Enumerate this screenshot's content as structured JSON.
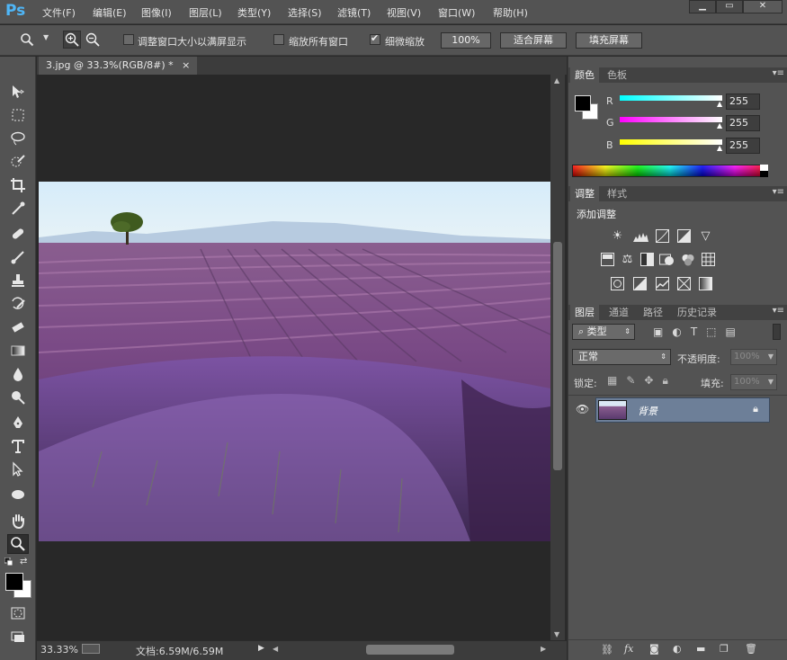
{
  "app": {
    "logo": "Ps"
  },
  "menu": [
    "文件(F)",
    "编辑(E)",
    "图像(I)",
    "图层(L)",
    "类型(Y)",
    "选择(S)",
    "滤镜(T)",
    "视图(V)",
    "窗口(W)",
    "帮助(H)"
  ],
  "window_controls": {
    "minimize": "▁",
    "restore": "▭",
    "close": "✕"
  },
  "options": {
    "fit_window_label": "调整窗口大小以满屏显示",
    "zoom_all_label": "缩放所有窗口",
    "scrubby_label": "细微缩放",
    "btn_100": "100%",
    "btn_fit": "适合屏幕",
    "btn_fill": "填充屏幕"
  },
  "document": {
    "tab_label": "3.jpg @ 33.3%(RGB/8#) *",
    "tab_close": "×",
    "zoom": "33.33%",
    "doc_size": "文档:6.59M/6.59M"
  },
  "color_panel": {
    "tabs": [
      "颜色",
      "色板"
    ],
    "channels": [
      {
        "label": "R",
        "value": "255"
      },
      {
        "label": "G",
        "value": "255"
      },
      {
        "label": "B",
        "value": "255"
      }
    ]
  },
  "adjust_panel": {
    "tabs": [
      "调整",
      "样式"
    ],
    "title": "添加调整"
  },
  "layers_panel": {
    "tabs": [
      "图层",
      "通道",
      "路径",
      "历史记录"
    ],
    "filter_kind": "类型",
    "blend_mode": "正常",
    "opacity_label": "不透明度:",
    "opacity_value": "100%",
    "lock_label": "锁定:",
    "fill_label": "填充:",
    "fill_value": "100%",
    "layer_name": "背景"
  },
  "colors": {
    "accent": "#4fb6f7",
    "layer_selected": "#6d7f98"
  }
}
